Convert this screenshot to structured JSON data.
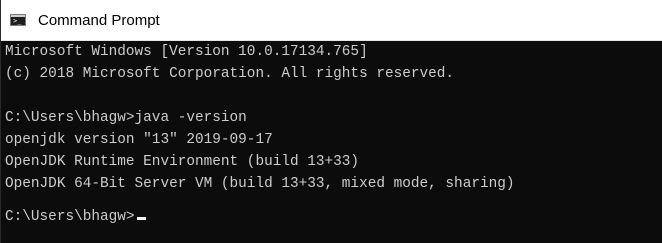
{
  "window": {
    "title": "Command Prompt",
    "icon": "console-icon",
    "icon_glyph": ">_"
  },
  "console": {
    "lines": [
      "Microsoft Windows [Version 10.0.17134.765]",
      "(c) 2018 Microsoft Corporation. All rights reserved.",
      "",
      "C:\\Users\\bhagw>java -version",
      "openjdk version \"13\" 2019-09-17",
      "OpenJDK Runtime Environment (build 13+33)",
      "OpenJDK 64-Bit Server VM (build 13+33, mixed mode, sharing)",
      "",
      "C:\\Users\\bhagw>"
    ]
  },
  "colors": {
    "background": "#0c0c0c",
    "text": "#cccccc",
    "titlebar": "#ffffff"
  }
}
